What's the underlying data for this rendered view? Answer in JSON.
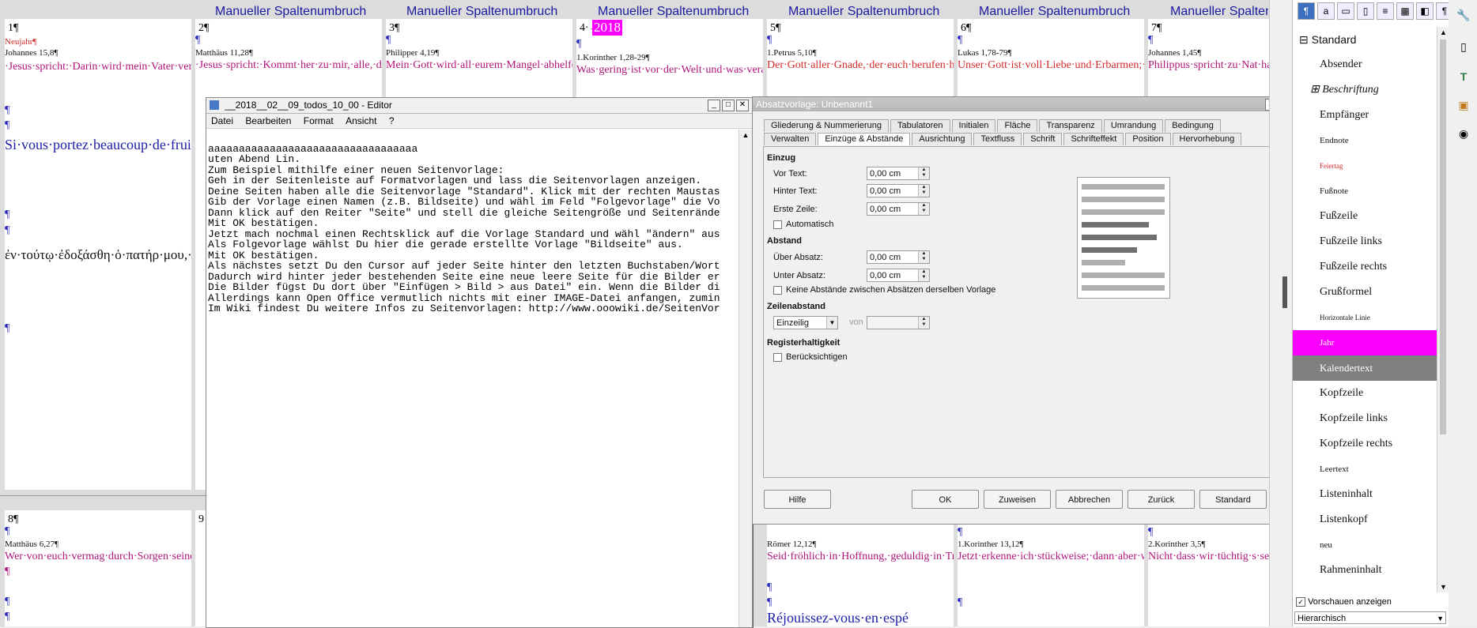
{
  "column_break_label": "Manueller Spaltenumbruch",
  "pilcrow": "¶",
  "pages": {
    "p1": {
      "num": "1¶",
      "heading": "Neujahr¶",
      "ref": "Johannes 15,8¶",
      "de": "·Jesus·spricht:·Darin·wird·mein·Vater·verherrlicht,·dass·ihr·viel·Frucht·bringt·und·werdet·meine·Jünger.¶",
      "fr": "Si·vous·portez·beaucoup·de·fruit,·c'est·ainsi·que·mon·Père·sera·glorifié,·et·que·vous·serez·mes·disciples.¶",
      "gr": "ἐν·τούτῳ·ἐδοξάσθη·ὁ·πατήρ·μου,·ἵνα·καρπὸν·πολὺν·φέρητε·καὶ·γένησθε·ἐμοὶ·μαθηταί.¶"
    },
    "p2": {
      "num": "2¶",
      "ref": "Matthäus 11,28¶",
      "de": "·Jesus·spricht:·Kommt·her·zu·mir,·alle,·die·ihr·mühselig·und·beladen·seid;·ich·will·euch·erquicken.¶"
    },
    "p3": {
      "num": "3¶",
      "ref": "Philipper 4,19¶",
      "de": "Mein·Gott·wird·all·eurem·Mangel·abhelfen·nach·seinem·Reichtum·in·Herrlichkeit·in·Christus·Jesus.¶"
    },
    "p4": {
      "num": "4·→",
      "year": "2018",
      "ref": "1.Korinther 1,28-29¶",
      "de": "Was·gering·ist·vor·der·Welt·und·was·verachtet·ist,·das·hat·Gott·erwählt,"
    },
    "p5": {
      "num": "5¶",
      "ref": "1.Petrus 5,10¶",
      "de": "Der·Gott·aller·Gnade,·der·euch·berufen·hat·zu·seiner·ewigen·Herrlichkeit·in·Christus,·der·wird·euch,·die"
    },
    "p6": {
      "num": "6¶",
      "ref": "Lukas 1,78-79¶",
      "de": "Unser·Gott·ist·voll·Liebe·und·Erbarmen;·er·schickt·uns·den·Retter,·das·Licht,·das·von·oben·kommt.·Dieses"
    },
    "p7": {
      "num": "7¶",
      "ref": "Johannes 1,45¶",
      "de": "Philippus·spricht·zu·Nat·haben·den·gefunden,·vo·im·Gesetz·und·die·Prop"
    },
    "p8": {
      "num": "8¶",
      "ref": "Matthäus 6,27¶",
      "de": "Wer·von·euch·vermag·durch·Sorgen·seiner·Lebenszeit·auch·nur·eine·Elle·hinzuzufügen?¶"
    },
    "p9": {
      "num": "9"
    },
    "p12": {
      "ref": "Römer 12,12¶",
      "de": "Seid·fröhlich·in·Hoffnung,·geduldig·in·Trübsal,·beharrlich·im·Gebet.¶",
      "fr": "Réjouissez-vous·en·espé"
    },
    "p13": {
      "ref": "1.Korinther 13,12¶",
      "de": "Jetzt·erkenne·ich·stückweise;·dann·aber·werde·ich·erkennen,·gleichwie·ich·erkannt·bin.¶"
    },
    "p14": {
      "ref": "2.Korinther 3,5¶",
      "de": "Nicht·dass·wir·tüchtig·s·selber,·uns·etwas·zuzure·von·uns·selber;·sondern·tüchtig·sind,·ist·von·Got"
    }
  },
  "editor": {
    "title": "__2018__02__09_todos_10_00 - Editor",
    "menu": [
      "Datei",
      "Bearbeiten",
      "Format",
      "Ansicht",
      "?"
    ],
    "lines": [
      "",
      "aaaaaaaaaaaaaaaaaaaaaaaaaaaaaaaaaa",
      "uten Abend Lin.",
      "Zum Beispiel mithilfe einer neuen Seitenvorlage:",
      "Geh in der Seitenleiste auf Formatvorlagen und lass die Seitenvorlagen anzeigen.",
      "Deine Seiten haben alle die Seitenvorlage \"Standard\". Klick mit der rechten Maustas",
      "Gib der Vorlage einen Namen (z.B. Bildseite) und wähl im Feld \"Folgevorlage\" die Vo",
      "Dann klick auf den Reiter \"Seite\" und stell die gleiche Seitengröße und Seitenrände",
      "Mit OK bestätigen.",
      "Jetzt mach nochmal einen Rechtsklick auf die Vorlage Standard und wähl \"ändern\" aus",
      "Als Folgevorlage wählst Du hier die gerade erstellte Vorlage \"Bildseite\" aus.",
      "Mit OK bestätigen.",
      "Als nächstes setzt Du den Cursor auf jeder Seite hinter den letzten Buchstaben/Wort",
      "Dadurch wird hinter jeder bestehenden Seite eine neue leere Seite für die Bilder er",
      "Die Bilder fügst Du dort über \"Einfügen > Bild > aus Datei\" ein. Wenn die Bilder di",
      "Allerdings kann Open Office vermutlich nichts mit einer IMAGE-Datei anfangen, zumin",
      "Im Wiki findest Du weitere Infos zu Seitenvorlagen: http://www.ooowiki.de/SeitenVor"
    ]
  },
  "dialog": {
    "title": "Absatzvorlage: Unbenannt1",
    "tabs_row1": [
      "Gliederung & Nummerierung",
      "Tabulatoren",
      "Initialen",
      "Fläche",
      "Transparenz",
      "Umrandung",
      "Bedingung"
    ],
    "tabs_row2": [
      "Verwalten",
      "Einzüge & Abstände",
      "Ausrichtung",
      "Textfluss",
      "Schrift",
      "Schrifteffekt",
      "Position",
      "Hervorhebung"
    ],
    "einzug": "Einzug",
    "vor_text": "Vor Text:",
    "hinter_text": "Hinter Text:",
    "erste_zeile": "Erste Zeile:",
    "automatisch": "Automatisch",
    "abstand": "Abstand",
    "ueber_absatz": "Über Absatz:",
    "unter_absatz": "Unter Absatz:",
    "keine_abstaende": "Keine Abstände zwischen Absätzen derselben Vorlage",
    "zeilenabstand": "Zeilenabstand",
    "zeilen_value": "Einzeilig",
    "von": "von",
    "registerhaltigkeit": "Registerhaltigkeit",
    "beruecksichtigen": "Berücksichtigen",
    "val": "0,00 cm",
    "buttons": {
      "hilfe": "Hilfe",
      "ok": "OK",
      "zuweisen": "Zuweisen",
      "abbrechen": "Abbrechen",
      "zurueck": "Zurück",
      "standard": "Standard"
    }
  },
  "styles": {
    "root": "Standard",
    "items": [
      "Absender",
      "Beschriftung",
      "Empfänger",
      "Endnote",
      "Feiertag",
      "Fußnote",
      "Fußzeile",
      "Fußzeile links",
      "Fußzeile rechts",
      "Grußformel",
      "Horizontale Linie",
      "Jahr",
      "Kalendertext",
      "Kopfzeile",
      "Kopfzeile links",
      "Kopfzeile rechts",
      "Leertext",
      "Listeninhalt",
      "Listenkopf",
      "neu",
      "Rahmeninhalt"
    ],
    "vorschau": "Vorschauen anzeigen",
    "filter": "Hierarchisch"
  }
}
